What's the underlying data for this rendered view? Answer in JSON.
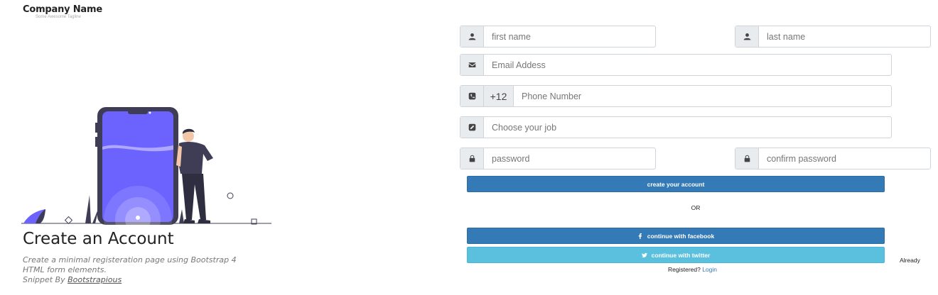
{
  "brand": {
    "name": "Company Name",
    "tagline": "Some Awesome Tagline"
  },
  "hero": {
    "title": "Create an Account",
    "desc_line1": "Create a minimal registeration page using Bootstrap 4",
    "desc_line2": "HTML form elements.",
    "snippet_prefix": "Snippet By ",
    "snippet_link": "Bootstrapious"
  },
  "form": {
    "first_name": {
      "placeholder": "first name",
      "icon": "user-icon"
    },
    "last_name": {
      "placeholder": "last name",
      "icon": "user-icon"
    },
    "email": {
      "placeholder": "Email Addess",
      "icon": "envelope-icon"
    },
    "phone": {
      "code": "+12",
      "placeholder": "Phone Number",
      "icon": "phone-square-icon"
    },
    "job": {
      "placeholder": "Choose your job",
      "icon": "pencil-square-icon"
    },
    "password": {
      "placeholder": "password",
      "icon": "lock-icon"
    },
    "confirm_password": {
      "placeholder": "confirm password",
      "icon": "lock-icon"
    }
  },
  "actions": {
    "create": "create your account",
    "or": "OR",
    "facebook": "continue with facebook",
    "twitter": "continue with twitter",
    "already": "Already",
    "registered": "Registered? ",
    "login": "Login"
  },
  "colors": {
    "primary": "#337ab7",
    "twitter": "#5bc0de",
    "illustration_accent": "#6c63ff",
    "illustration_dark": "#3f3d56"
  }
}
